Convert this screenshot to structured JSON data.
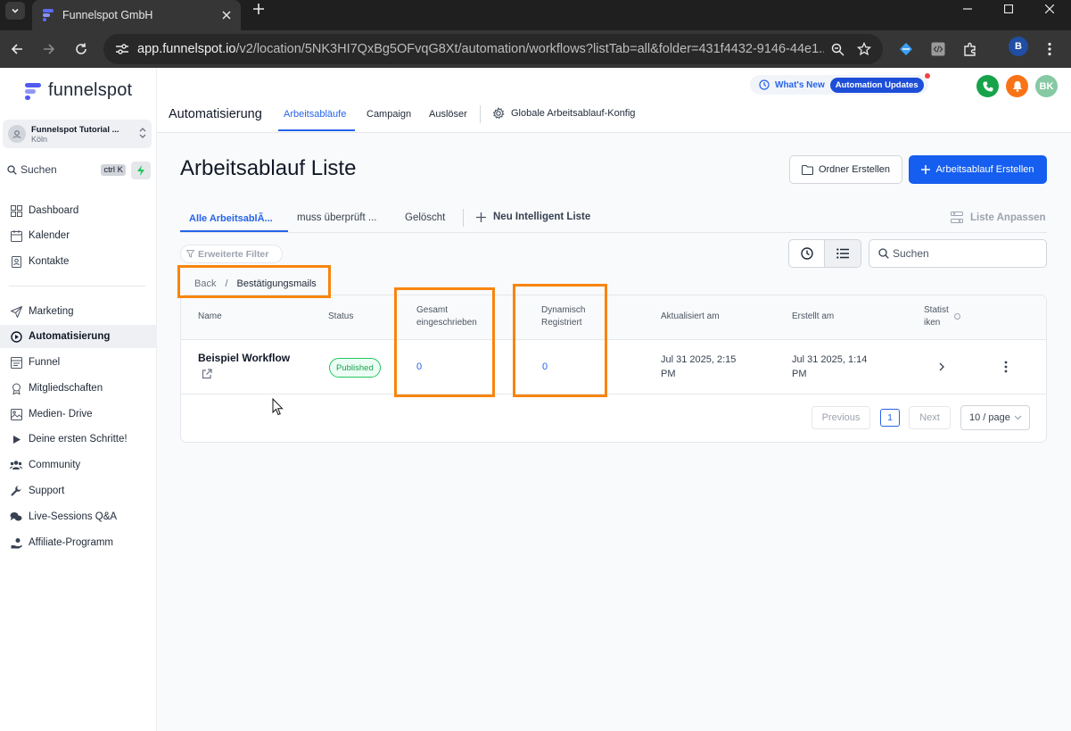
{
  "browser": {
    "tab_title": "Funnelspot GmbH",
    "url_host": "app.funnelspot.io",
    "url_path": "/v2/location/5NK3HI7QxBg5OFvqG8Xt/automation/workflows?listTab=all&folder=431f4432-9146-44e1...",
    "profile_initial": "B"
  },
  "sidebar": {
    "brand": "funnelspot",
    "account_name": "Funnelspot Tutorial ...",
    "account_location": "Köln",
    "search_label": "Suchen",
    "search_shortcut": "ctrl K",
    "items": [
      {
        "label": "Dashboard"
      },
      {
        "label": "Kalender"
      },
      {
        "label": "Kontakte"
      },
      {
        "label": "Marketing"
      },
      {
        "label": "Automatisierung"
      },
      {
        "label": "Funnel"
      },
      {
        "label": "Mitgliedschaften"
      },
      {
        "label": "Medien- Drive"
      },
      {
        "label": "Deine ersten Schritte!"
      },
      {
        "label": "Community"
      },
      {
        "label": "Support"
      },
      {
        "label": "Live-Sessions Q&A"
      },
      {
        "label": "Affiliate-Programm"
      }
    ]
  },
  "topbar": {
    "whats_new": "What's New",
    "automation_updates": "Automation Updates",
    "user_initials": "BK",
    "title": "Automatisierung",
    "tabs": [
      {
        "label": "Arbeitsabläufe"
      },
      {
        "label": "Campaign"
      },
      {
        "label": "Auslöser"
      },
      {
        "label": "Globale Arbeitsablauf-Konfig"
      }
    ]
  },
  "main": {
    "heading": "Arbeitsablauf Liste",
    "btn_folder": "Ordner Erstellen",
    "btn_create": "Arbeitsablauf Erstellen",
    "list_tabs": [
      {
        "label": "Alle ArbeitsablÃ..."
      },
      {
        "label": "muss überprüft ..."
      },
      {
        "label": "Gelöscht"
      }
    ],
    "new_list": "Neu Intelligent Liste",
    "customize": "Liste Anpassen",
    "filter": "Erweiterte Filter",
    "search_placeholder": "Suchen",
    "breadcrumb": {
      "back": "Back",
      "separator": "/",
      "current": "Bestätigungsmails"
    }
  },
  "table": {
    "headers": {
      "name": "Name",
      "status": "Status",
      "total_line1": "Gesamt",
      "total_line2": "eingeschrieben",
      "dynamic_line1": "Dynamisch",
      "dynamic_line2": "Registriert",
      "updated": "Aktualisiert am",
      "created": "Erstellt am",
      "stats_line1": "Statist",
      "stats_line2": "iken"
    },
    "rows": [
      {
        "name": "Beispiel Workflow",
        "status": "Published",
        "total": "0",
        "dynamic": "0",
        "updated_line1": "Jul 31 2025, 2:15",
        "updated_line2": "PM",
        "created_line1": "Jul 31 2025, 1:14",
        "created_line2": "PM"
      }
    ]
  },
  "pagination": {
    "previous": "Previous",
    "current": "1",
    "next": "Next",
    "per_page": "10 / page"
  },
  "colors": {
    "accent": "#155eef",
    "highlight": "#f7850e",
    "published": "#16a34a"
  }
}
